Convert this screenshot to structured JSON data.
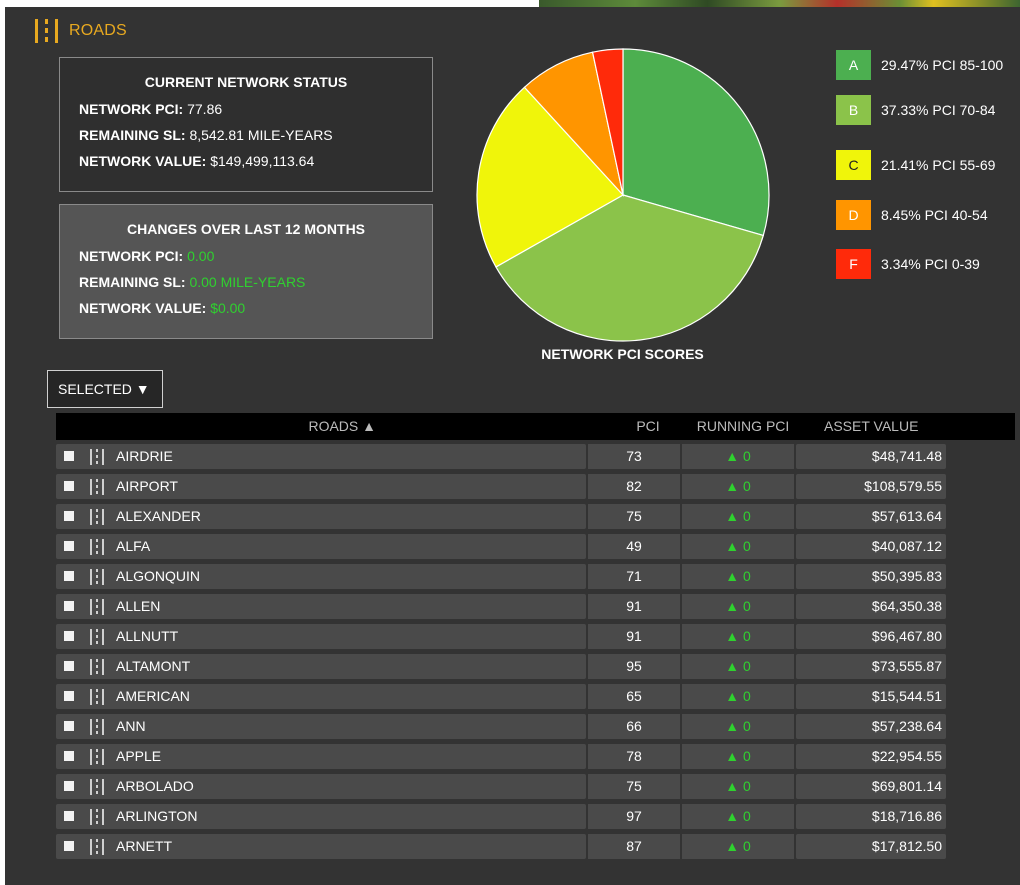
{
  "header": {
    "title": "ROADS",
    "icon": "road-icon"
  },
  "status": {
    "title": "CURRENT NETWORK STATUS",
    "pci_label": "NETWORK PCI:",
    "pci_value": "77.86",
    "sl_label": "REMAINING SL:",
    "sl_value": "8,542.81 MILE-YEARS",
    "value_label": "NETWORK VALUE:",
    "value_value": "$149,499,113.64"
  },
  "changes": {
    "title": "CHANGES OVER LAST 12 MONTHS",
    "pci_label": "NETWORK PCI:",
    "pci_value": "0.00",
    "sl_label": "REMAINING SL:",
    "sl_value": "0.00 MILE-YEARS",
    "value_label": "NETWORK VALUE:",
    "value_value": "$0.00",
    "value_color": "#2fd12f"
  },
  "chart_data": {
    "type": "pie",
    "title": "NETWORK PCI SCORES",
    "categories": [
      "A",
      "B",
      "C",
      "D",
      "F"
    ],
    "values": [
      29.47,
      37.33,
      21.41,
      8.45,
      3.34
    ],
    "colors": [
      "#4caf50",
      "#8bc34a",
      "#f0f50a",
      "#ff9500",
      "#ff2a0a"
    ],
    "legend_placement": "right",
    "legend": [
      {
        "grade": "A",
        "text": "29.47% PCI 85-100"
      },
      {
        "grade": "B",
        "text": "37.33% PCI 70-84"
      },
      {
        "grade": "C",
        "text": "21.41% PCI 55-69"
      },
      {
        "grade": "D",
        "text": "8.45% PCI 40-54"
      },
      {
        "grade": "F",
        "text": "3.34% PCI 0-39"
      }
    ]
  },
  "filter": {
    "label": "SELECTED ▼"
  },
  "table": {
    "columns": {
      "roads": "ROADS ▲",
      "pci": "PCI",
      "running": "RUNNING PCI",
      "asset": "ASSET VALUE"
    },
    "rows": [
      {
        "name": "AIRDRIE",
        "pci": "73",
        "running": "▲ 0",
        "asset": "$48,741.48"
      },
      {
        "name": "AIRPORT",
        "pci": "82",
        "running": "▲ 0",
        "asset": "$108,579.55"
      },
      {
        "name": "ALEXANDER",
        "pci": "75",
        "running": "▲ 0",
        "asset": "$57,613.64"
      },
      {
        "name": "ALFA",
        "pci": "49",
        "running": "▲ 0",
        "asset": "$40,087.12"
      },
      {
        "name": "ALGONQUIN",
        "pci": "71",
        "running": "▲ 0",
        "asset": "$50,395.83"
      },
      {
        "name": "ALLEN",
        "pci": "91",
        "running": "▲ 0",
        "asset": "$64,350.38"
      },
      {
        "name": "ALLNUTT",
        "pci": "91",
        "running": "▲ 0",
        "asset": "$96,467.80"
      },
      {
        "name": "ALTAMONT",
        "pci": "95",
        "running": "▲ 0",
        "asset": "$73,555.87"
      },
      {
        "name": "AMERICAN",
        "pci": "65",
        "running": "▲ 0",
        "asset": "$15,544.51"
      },
      {
        "name": "ANN",
        "pci": "66",
        "running": "▲ 0",
        "asset": "$57,238.64"
      },
      {
        "name": "APPLE",
        "pci": "78",
        "running": "▲ 0",
        "asset": "$22,954.55"
      },
      {
        "name": "ARBOLADO",
        "pci": "75",
        "running": "▲ 0",
        "asset": "$69,801.14"
      },
      {
        "name": "ARLINGTON",
        "pci": "97",
        "running": "▲ 0",
        "asset": "$18,716.86"
      },
      {
        "name": "ARNETT",
        "pci": "87",
        "running": "▲ 0",
        "asset": "$17,812.50"
      }
    ]
  }
}
